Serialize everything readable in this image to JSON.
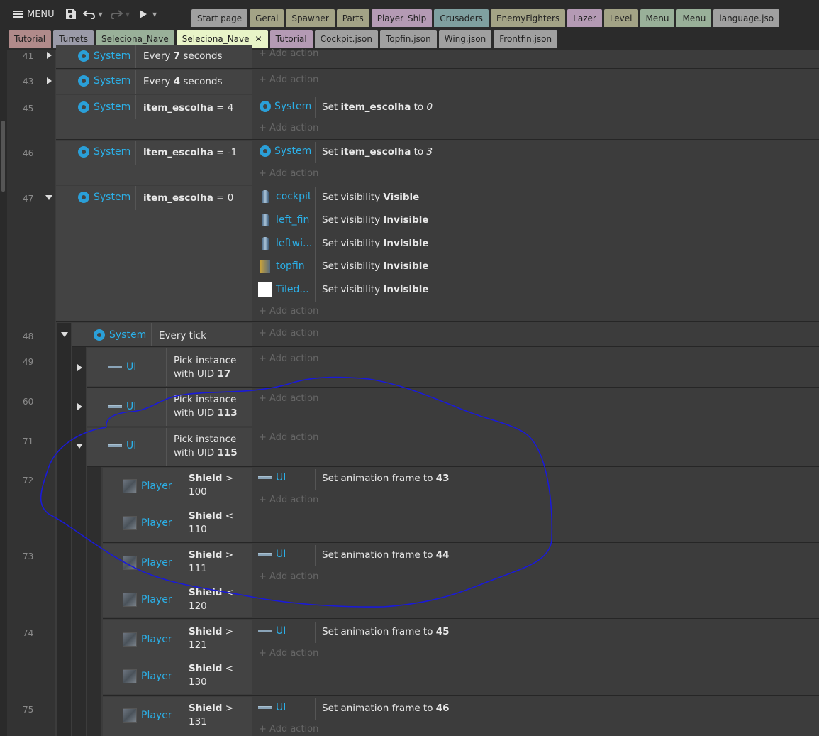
{
  "toolbar": {
    "menu_label": "MENU",
    "icons": [
      "menu-icon",
      "save-icon",
      "undo-icon",
      "redo-icon",
      "play-icon"
    ]
  },
  "tabs_row1": [
    {
      "label": "Start page",
      "color": "#a0a0a0"
    },
    {
      "label": "Geral",
      "color": "#a3a386"
    },
    {
      "label": "Spawner",
      "color": "#a3a386"
    },
    {
      "label": "Parts",
      "color": "#a3a386"
    },
    {
      "label": "Player_Ship",
      "color": "#b49ab4"
    },
    {
      "label": "Crusaders",
      "color": "#7fa0a0"
    },
    {
      "label": "EnemyFighters",
      "color": "#a3a386"
    },
    {
      "label": "Lazer",
      "color": "#b49ab4"
    },
    {
      "label": "Level",
      "color": "#a3a386"
    },
    {
      "label": "Menu",
      "color": "#99b099"
    },
    {
      "label": "Menu",
      "color": "#99b099"
    },
    {
      "label": "language.jso",
      "color": "#a0a0a0"
    }
  ],
  "tabs_row2": [
    {
      "label": "Tutorial",
      "color": "#b08a8a"
    },
    {
      "label": "Turrets",
      "color": "#9a9aa8"
    },
    {
      "label": "Seleciona_Nave",
      "color": "#99b099"
    },
    {
      "label": "Seleciona_Nave",
      "color": "#e8f4c8",
      "active": true,
      "close": "✕"
    },
    {
      "label": "Tutorial",
      "color": "#b49ab4"
    },
    {
      "label": "Cockpit.json",
      "color": "#a0a0a0"
    },
    {
      "label": "Topfin.json",
      "color": "#a0a0a0"
    },
    {
      "label": "Wing.json",
      "color": "#a0a0a0"
    },
    {
      "label": "Frontfin.json",
      "color": "#a0a0a0"
    }
  ],
  "add_action": "+ Add action",
  "events": {
    "e41": {
      "num": "41",
      "obj": "System",
      "pre": "Every ",
      "val": "7",
      "post": " seconds"
    },
    "e43": {
      "num": "43",
      "obj": "System",
      "pre": "Every ",
      "val": "4",
      "post": " seconds"
    },
    "e45": {
      "num": "45",
      "obj": "System",
      "var": "item_escolha",
      "op": " = 4",
      "act_obj": "System",
      "act_pre": "Set ",
      "act_var": "item_escolha",
      "act_mid": " to ",
      "act_val": "0"
    },
    "e46": {
      "num": "46",
      "obj": "System",
      "var": "item_escolha",
      "op": " = -1",
      "act_obj": "System",
      "act_pre": "Set ",
      "act_var": "item_escolha",
      "act_mid": " to ",
      "act_val": "3"
    },
    "e47": {
      "num": "47",
      "obj": "System",
      "var": "item_escolha",
      "op": " = 0",
      "actions": [
        {
          "obj": "cockpit",
          "pre": "Set visibility ",
          "val": "Visible"
        },
        {
          "obj": "left_fin",
          "pre": "Set visibility ",
          "val": "Invisible"
        },
        {
          "obj": "leftwi...",
          "pre": "Set visibility ",
          "val": "Invisible"
        },
        {
          "obj": "topfin",
          "pre": "Set visibility ",
          "val": "Invisible"
        },
        {
          "obj": "Tiled...",
          "pre": "Set visibility ",
          "val": "Invisible"
        }
      ]
    },
    "e48": {
      "num": "48",
      "obj": "System",
      "text": "Every tick"
    },
    "e49": {
      "num": "49",
      "obj": "UI",
      "line1": "Pick instance",
      "line2pre": "with UID ",
      "uid": "17"
    },
    "e60": {
      "num": "60",
      "obj": "UI",
      "line1": "Pick instance",
      "line2pre": "with UID ",
      "uid": "113"
    },
    "e71": {
      "num": "71",
      "obj": "UI",
      "line1": "Pick instance",
      "line2pre": "with UID ",
      "uid": "115"
    },
    "e72": {
      "num": "72",
      "c1_obj": "Player",
      "c1_var": "Shield",
      "c1_op": " >",
      "c1_val": "100",
      "c2_obj": "Player",
      "c2_var": "Shield",
      "c2_op": " <",
      "c2_val": "110",
      "act_obj": "UI",
      "act_pre": "Set animation frame to ",
      "act_val": "43"
    },
    "e73": {
      "num": "73",
      "c1_obj": "Player",
      "c1_var": "Shield",
      "c1_op": " >",
      "c1_val": "111",
      "c2_obj": "Player",
      "c2_var": "Shield",
      "c2_op": " <",
      "c2_val": "120",
      "act_obj": "UI",
      "act_pre": "Set animation frame to ",
      "act_val": "44"
    },
    "e74": {
      "num": "74",
      "c1_obj": "Player",
      "c1_var": "Shield",
      "c1_op": " >",
      "c1_val": "121",
      "c2_obj": "Player",
      "c2_var": "Shield",
      "c2_op": " <",
      "c2_val": "130",
      "act_obj": "UI",
      "act_pre": "Set animation frame to ",
      "act_val": "45"
    },
    "e75": {
      "num": "75",
      "c1_obj": "Player",
      "c1_var": "Shield",
      "c1_op": " >",
      "c1_val": "131",
      "act_obj": "UI",
      "act_pre": "Set animation frame to ",
      "act_val": "46"
    }
  },
  "colors": {
    "accent": "#2bb0e8",
    "annotation": "#1a1ad8"
  }
}
